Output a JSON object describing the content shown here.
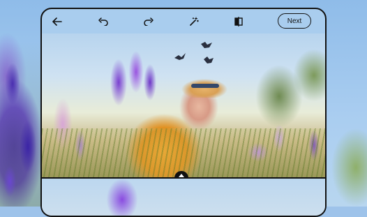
{
  "toolbar": {
    "back_icon": "arrow-left-icon",
    "undo_icon": "undo-icon",
    "redo_icon": "redo-icon",
    "magic_icon": "magic-wand-icon",
    "compare_icon": "compare-icon",
    "next_label": "Next"
  },
  "split_handle": {
    "icon": "up-down-arrows-icon"
  },
  "colors": {
    "frame": "#111111",
    "background_sky": "#9ec3ea"
  }
}
